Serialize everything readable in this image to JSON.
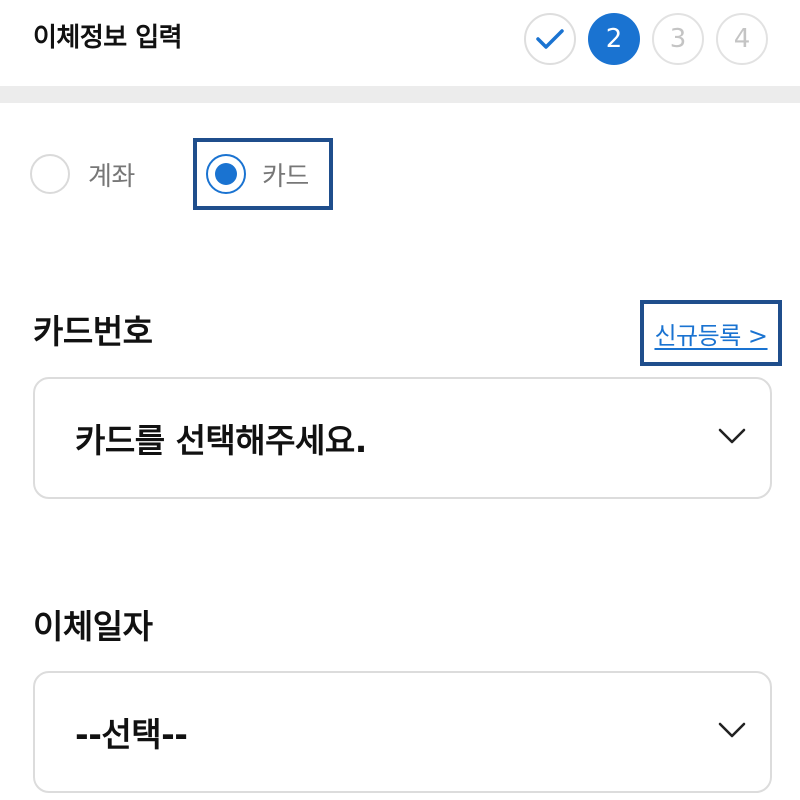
{
  "header": {
    "title": "이체정보 입력",
    "steps": [
      {
        "label": "",
        "state": "done",
        "icon": "check-icon"
      },
      {
        "label": "2",
        "state": "current"
      },
      {
        "label": "3",
        "state": "todo"
      },
      {
        "label": "4",
        "state": "todo"
      }
    ]
  },
  "payment_method": {
    "options": [
      {
        "label": "계좌",
        "selected": false
      },
      {
        "label": "카드",
        "selected": true
      }
    ]
  },
  "card_number": {
    "title": "카드번호",
    "new_register_label": "신규등록 >",
    "select_value": "카드를 선택해주세요."
  },
  "transfer_date": {
    "title": "이체일자",
    "select_value": "--선택--"
  },
  "colors": {
    "accent": "#1a73d1",
    "highlight_border": "#1f4e8c",
    "divider": "#ececec"
  }
}
